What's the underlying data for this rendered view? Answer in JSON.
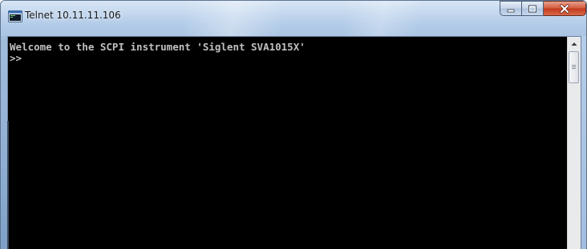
{
  "window": {
    "title": "Telnet 10.11.11.106",
    "app_icon": "terminal-window-icon",
    "controls": {
      "minimize_icon": "minimize-icon",
      "maximize_icon": "maximize-icon",
      "close_icon": "close-icon"
    }
  },
  "console": {
    "lines": [
      "Welcome to the SCPI instrument 'Siglent SVA1015X'",
      ">>"
    ],
    "text_color": "#c0c0c0",
    "background_color": "#000000"
  },
  "scrollbar": {
    "up_icon": "scroll-up-arrow-icon",
    "thumb_grip_icon": "grip-icon"
  },
  "colors": {
    "close_button": "#c94a2c",
    "titlebar": "#b9cfea"
  }
}
